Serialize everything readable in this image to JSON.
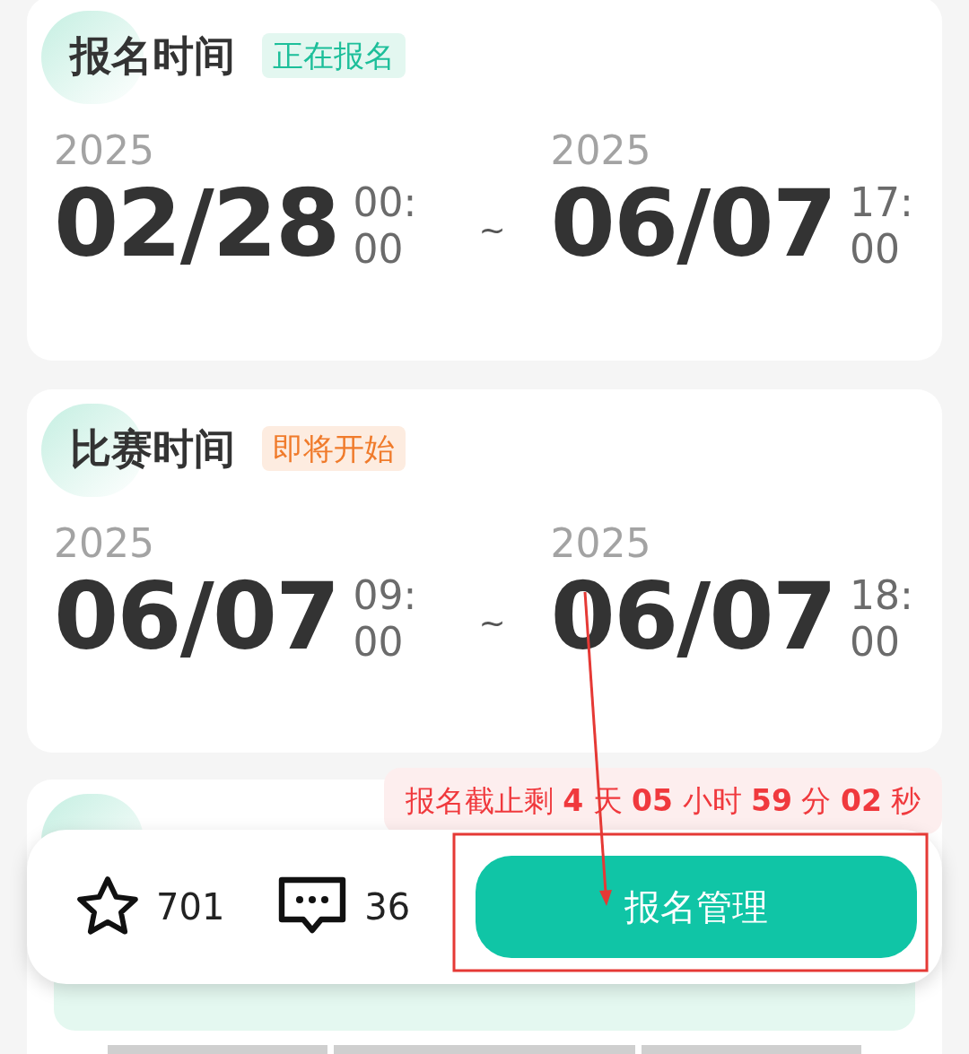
{
  "sections": [
    {
      "title": "报名时间",
      "status": {
        "label": "正在报名",
        "kind": "open"
      },
      "start": {
        "year": "2025",
        "date": "02/28",
        "time": "00:00"
      },
      "separator": "~",
      "end": {
        "year": "2025",
        "date": "06/07",
        "time": "17:00"
      }
    },
    {
      "title": "比赛时间",
      "status": {
        "label": "即将开始",
        "kind": "upcoming"
      },
      "start": {
        "year": "2025",
        "date": "06/07",
        "time": "09:00"
      },
      "separator": "~",
      "end": {
        "year": "2025",
        "date": "06/07",
        "time": "18:00"
      }
    }
  ],
  "countdown": "报名截止剩 **4** 天 **05** 小时 **59** 分 **02** 秒",
  "action_bar": {
    "favorites": "701",
    "comments": "36",
    "button": "报名管理"
  }
}
